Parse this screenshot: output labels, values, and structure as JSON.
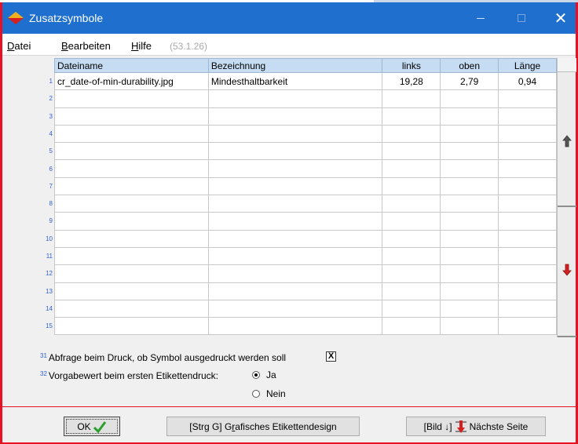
{
  "window": {
    "title": "Zusatzsymbole",
    "controls": {
      "minimize": "—",
      "maximize": "☐",
      "close": "✕"
    },
    "accent_color": "#1e6fce",
    "border_color": "#e81123"
  },
  "menu": {
    "items": [
      {
        "label_u": "D",
        "label_rest": "atei",
        "left": "Datei"
      },
      {
        "label_u": "B",
        "label_rest": "earbeiten"
      },
      {
        "label_u": "H",
        "label_rest": "ilfe"
      }
    ],
    "version": "(53.1.26)"
  },
  "grid": {
    "columns": [
      "Dateiname",
      "Bezeichnung",
      "links",
      "oben",
      "Länge"
    ],
    "row_numbers": [
      "1",
      "2",
      "3",
      "4",
      "5",
      "6",
      "7",
      "8",
      "9",
      "10",
      "11",
      "12",
      "13",
      "14",
      "15"
    ],
    "rows": [
      [
        "cr_date-of-min-durability.jpg",
        "Mindesthaltbarkeit",
        "19,28",
        "2,79",
        "0,94"
      ],
      [
        "",
        "",
        "",
        "",
        ""
      ],
      [
        "",
        "",
        "",
        "",
        ""
      ],
      [
        "",
        "",
        "",
        "",
        ""
      ],
      [
        "",
        "",
        "",
        "",
        ""
      ],
      [
        "",
        "",
        "",
        "",
        ""
      ],
      [
        "",
        "",
        "",
        "",
        ""
      ],
      [
        "",
        "",
        "",
        "",
        ""
      ],
      [
        "",
        "",
        "",
        "",
        ""
      ],
      [
        "",
        "",
        "",
        "",
        ""
      ],
      [
        "",
        "",
        "",
        "",
        ""
      ],
      [
        "",
        "",
        "",
        "",
        ""
      ],
      [
        "",
        "",
        "",
        "",
        ""
      ],
      [
        "",
        "",
        "",
        "",
        ""
      ],
      [
        "",
        "",
        "",
        "",
        ""
      ]
    ],
    "scroll_up_icon": "arrow-up-icon",
    "scroll_down_icon": "arrow-down-icon"
  },
  "options": {
    "print_query": {
      "number": "31",
      "label": "Abfrage beim Druck, ob Symbol ausgedruckt werden soll",
      "checked": "X"
    },
    "default_value": {
      "number": "32",
      "label": "Vorgabewert beim ersten Etikettendruck:",
      "choices": [
        "Ja",
        "Nein"
      ],
      "selected": "Ja"
    }
  },
  "buttons": {
    "ok": "OK",
    "design_prefix": "[Strg G] G",
    "design_u": "r",
    "design_rest": "afisches Etikettendesign",
    "next_prefix": "[Bild ↓]",
    "next_label": "Nächste Seite"
  }
}
